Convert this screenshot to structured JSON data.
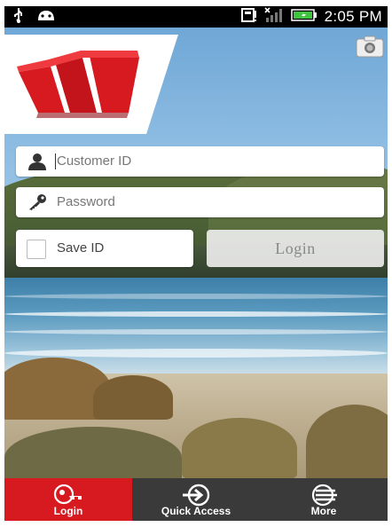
{
  "status_bar": {
    "time": "2:05 PM",
    "icons": [
      "usb-icon",
      "android-debug-icon",
      "notification-icon",
      "signal-icon",
      "battery-icon"
    ]
  },
  "brand": {
    "logo": "westpac-logo",
    "accent_color": "#d71920"
  },
  "form": {
    "customer_id_placeholder": "Customer ID",
    "password_placeholder": "Password",
    "save_id_label": "Save ID",
    "save_id_checked": false,
    "login_label": "Login"
  },
  "tabs": [
    {
      "label": "Login",
      "icon": "key-icon",
      "active": true
    },
    {
      "label": "Quick Access",
      "icon": "arrow-in-circle-icon",
      "active": false
    },
    {
      "label": "More",
      "icon": "menu-lines-icon",
      "active": false
    }
  ]
}
